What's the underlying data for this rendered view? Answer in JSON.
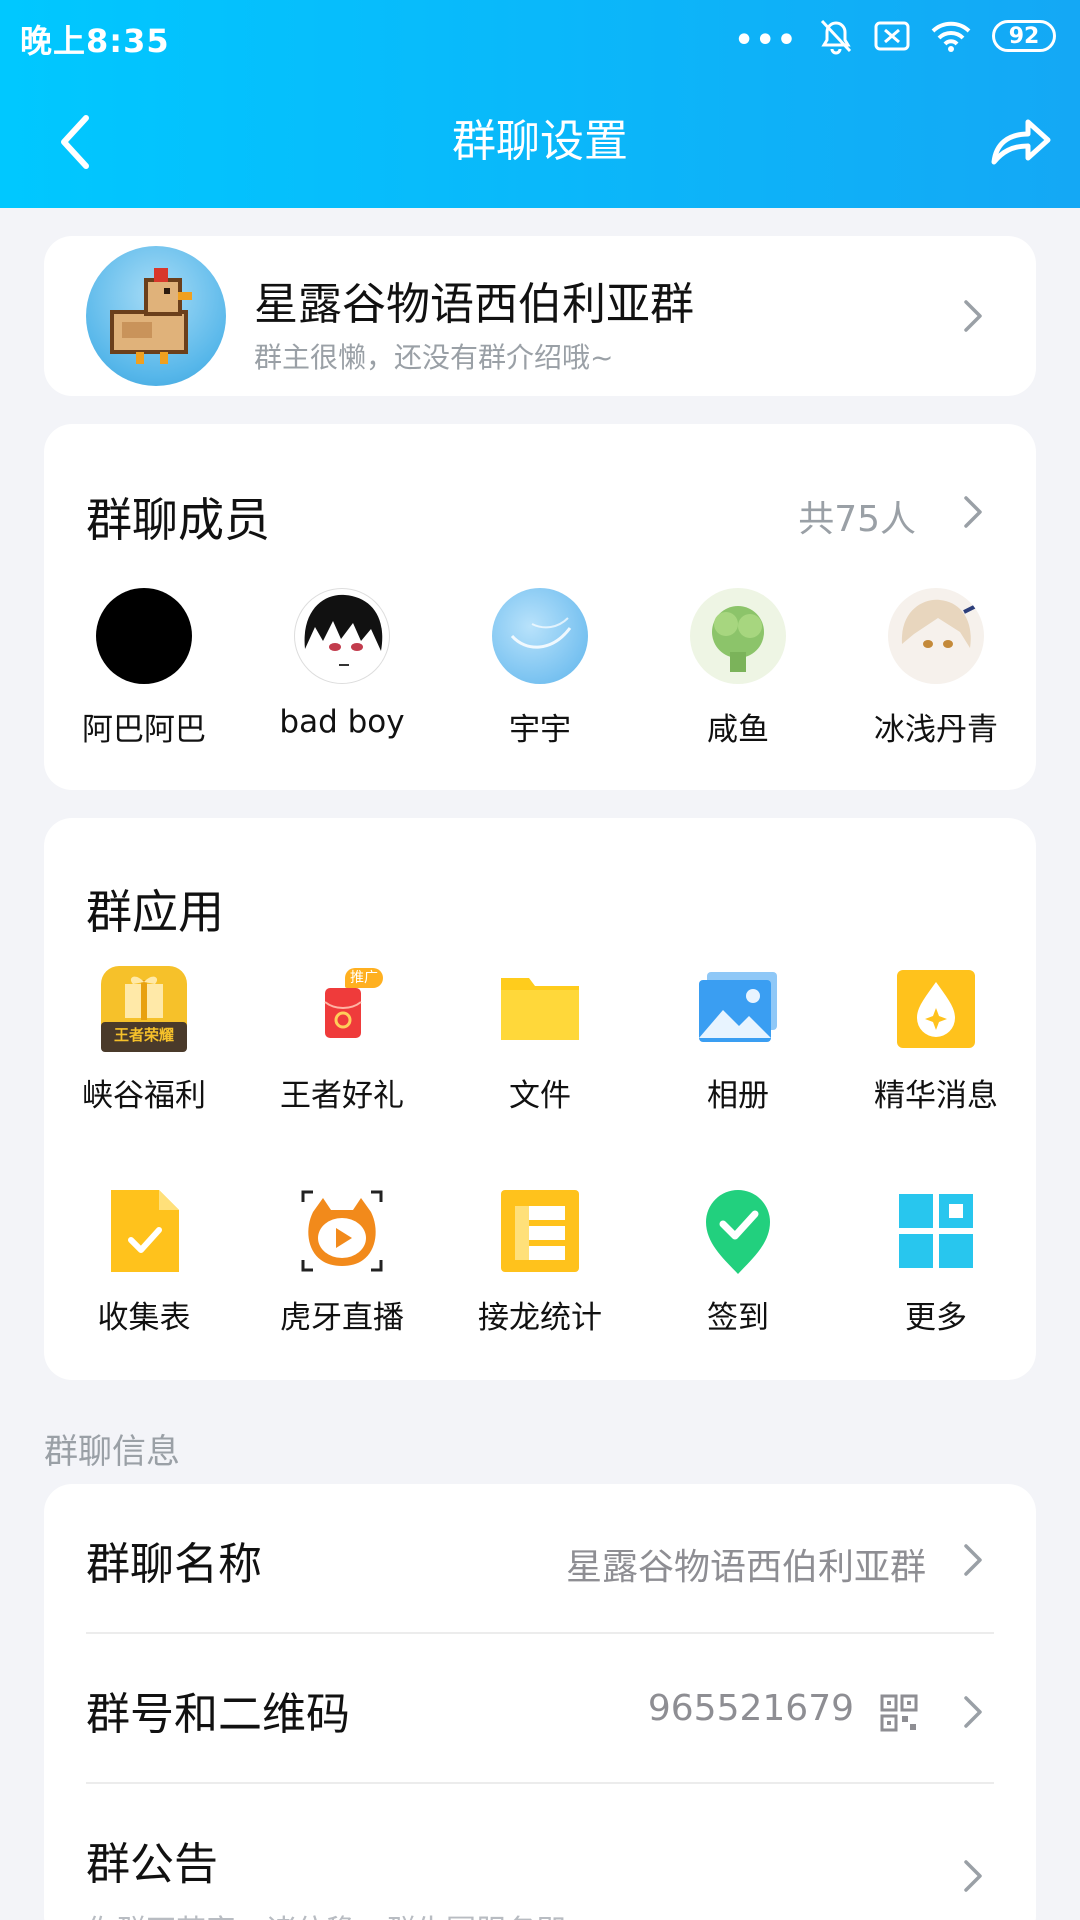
{
  "status_bar": {
    "time": "晚上8:35",
    "battery": "92",
    "dots": "•••"
  },
  "header": {
    "title": "群聊设置"
  },
  "group": {
    "name": "星露谷物语西伯利亚群",
    "description": "群主很懒，还没有群介绍哦~"
  },
  "members": {
    "title": "群聊成员",
    "count": "共75人",
    "items": [
      {
        "name": "阿巴阿巴"
      },
      {
        "name": "bad boy"
      },
      {
        "name": "宇宇"
      },
      {
        "name": "咸鱼"
      },
      {
        "name": "冰浅丹青"
      }
    ]
  },
  "apps": {
    "title": "群应用",
    "items": [
      {
        "label": "峡谷福利",
        "icon": "gift-icon",
        "icon_text": "王者荣耀"
      },
      {
        "label": "王者好礼",
        "icon": "red-packet-icon",
        "badge": "推广"
      },
      {
        "label": "文件",
        "icon": "folder-icon"
      },
      {
        "label": "相册",
        "icon": "album-icon"
      },
      {
        "label": "精华消息",
        "icon": "essence-icon"
      },
      {
        "label": "收集表",
        "icon": "form-icon"
      },
      {
        "label": "虎牙直播",
        "icon": "huya-icon"
      },
      {
        "label": "接龙统计",
        "icon": "relay-icon"
      },
      {
        "label": "签到",
        "icon": "checkin-icon"
      },
      {
        "label": "更多",
        "icon": "more-apps-icon"
      }
    ]
  },
  "info": {
    "section_label": "群聊信息",
    "name_row": {
      "title": "群聊名称",
      "value": "星露谷物语西伯利亚群"
    },
    "number_row": {
      "title": "群号和二维码",
      "value": "965521679"
    },
    "notice_row": {
      "title": "群公告",
      "subtitle": "你群不若富，诸位稳，群生圆服务即"
    }
  }
}
